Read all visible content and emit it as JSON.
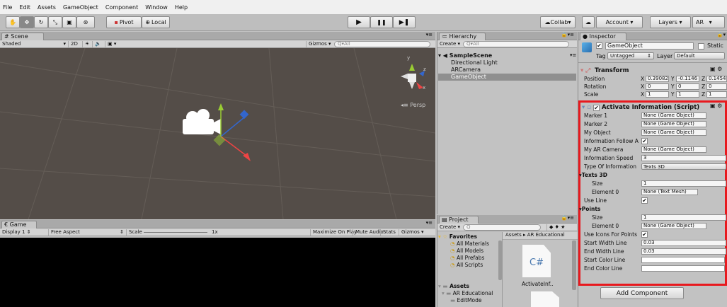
{
  "menu": [
    "File",
    "Edit",
    "Assets",
    "GameObject",
    "Component",
    "Window",
    "Help"
  ],
  "toolbar": {
    "pivot": "Pivot",
    "local": "Local",
    "collab": "Collab",
    "account": "Account",
    "layers": "Layers",
    "layout": "AR"
  },
  "scene": {
    "tab": "Scene",
    "shading": "Shaded",
    "mode2d": "2D",
    "gizmos": "Gizmos",
    "search": "All",
    "persp": "Persp"
  },
  "game": {
    "tab": "Game",
    "display": "Display 1",
    "aspect": "Free Aspect",
    "scale_label": "Scale",
    "scale_value": "1x",
    "max_on_play": "Maximize On Play",
    "mute": "Mute Audio",
    "stats": "Stats",
    "gizmos": "Gizmos"
  },
  "hierarchy": {
    "tab": "Hierarchy",
    "create": "Create",
    "search": "All",
    "scene": "SampleScene",
    "items": [
      "Directional Light",
      "ARCamera",
      "GameObject"
    ]
  },
  "project": {
    "tab": "Project",
    "create": "Create",
    "favorites": "Favorites",
    "fav_items": [
      "All Materials",
      "All Models",
      "All Prefabs",
      "All Scripts"
    ],
    "breadcrumb": "Assets ▸ AR Educational",
    "assets": "Assets",
    "asset_items": [
      "AR Educational",
      "EditMode"
    ],
    "file_icon": "C#",
    "file_name": "ActivateInf.."
  },
  "inspector": {
    "tab": "Inspector",
    "name": "GameObject",
    "static": "Static",
    "tag_label": "Tag",
    "tag": "Untagged",
    "layer_label": "Layer",
    "layer": "Default",
    "transform": {
      "title": "Transform",
      "rows": [
        {
          "label": "Position",
          "x": "0.39082",
          "y": "-0.1146",
          "z": "0.1454"
        },
        {
          "label": "Rotation",
          "x": "0",
          "y": "0",
          "z": "0"
        },
        {
          "label": "Scale",
          "x": "1",
          "y": "1",
          "z": "1"
        }
      ]
    },
    "script": {
      "title": "Activate Information (Script)",
      "marker1": "Marker 1",
      "marker2": "Marker 2",
      "my_object": "My Object",
      "none_go": "None (Game Object)",
      "info_follow": "Information Follow A",
      "my_ar_camera": "My AR Camera",
      "info_speed": "Information Speed",
      "info_speed_val": "3",
      "type_info": "Type Of Information",
      "type_info_val": "Texts 3D",
      "texts3d": "Texts 3D",
      "size": "Size",
      "size_val": "1",
      "element0": "Element 0",
      "none_tm": "None (Text Mesh)",
      "use_line": "Use Line",
      "points": "Points",
      "use_icons": "Use Icons For Points",
      "start_width": "Start Width Line",
      "start_width_val": "0.03",
      "end_width": "End Width Line",
      "end_width_val": "0.03",
      "start_color": "Start Color Line",
      "end_color": "End Color Line"
    },
    "add_component": "Add Component"
  },
  "colors": {
    "highlight": "#e8191e",
    "scene_bg": "#544d48"
  }
}
